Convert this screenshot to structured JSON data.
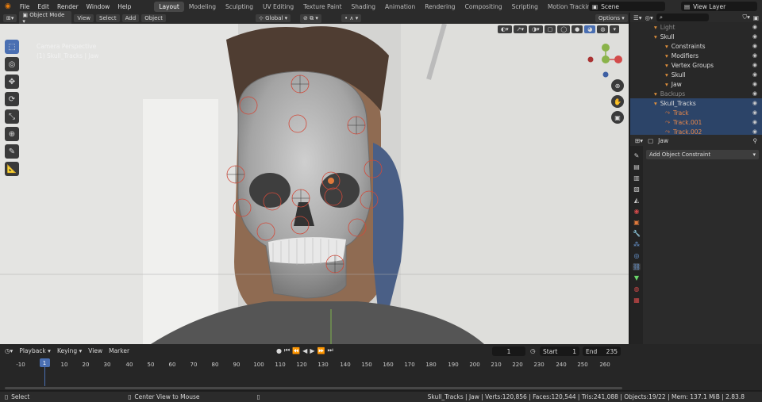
{
  "menus": [
    "File",
    "Edit",
    "Render",
    "Window",
    "Help"
  ],
  "workspaces": [
    "Layout",
    "Modeling",
    "Sculpting",
    "UV Editing",
    "Texture Paint",
    "Shading",
    "Animation",
    "Rendering",
    "Compositing",
    "Scripting",
    "Motion Tracking"
  ],
  "add_workspace": "+",
  "scene": "Scene",
  "view_layer": "View Layer",
  "header": {
    "mode": "Object Mode",
    "view": "View",
    "select": "Select",
    "add": "Add",
    "object": "Object",
    "orientation": "Global",
    "options": "Options"
  },
  "overlay": {
    "perspective": "Camera Perspective",
    "context": "(1) Skull_Tracks | Jaw"
  },
  "outliner": {
    "search_placeholder": "",
    "rows": [
      {
        "label": "Light",
        "indent": 30,
        "dim": true,
        "sel": false
      },
      {
        "label": "Skull",
        "indent": 30,
        "dim": false,
        "sel": false
      },
      {
        "label": "Constraints",
        "indent": 44,
        "dim": false,
        "sel": false
      },
      {
        "label": "Modifiers",
        "indent": 44,
        "dim": false,
        "sel": false
      },
      {
        "label": "Vertex Groups",
        "indent": 44,
        "dim": false,
        "sel": false
      },
      {
        "label": "Skull",
        "indent": 44,
        "dim": false,
        "sel": false
      },
      {
        "label": "Jaw",
        "indent": 44,
        "dim": false,
        "sel": false
      },
      {
        "label": "Backups",
        "indent": 30,
        "dim": true,
        "sel": false
      },
      {
        "label": "Skull_Tracks",
        "indent": 30,
        "dim": false,
        "sel": true
      },
      {
        "label": "Track",
        "indent": 44,
        "dim": false,
        "sel": true,
        "orange": true
      },
      {
        "label": "Track.001",
        "indent": 44,
        "dim": false,
        "sel": true,
        "orange": true
      },
      {
        "label": "Track.002",
        "indent": 44,
        "dim": false,
        "sel": true,
        "orange": true
      }
    ]
  },
  "properties": {
    "object": "Jaw",
    "add_constraint": "Add Object Constraint"
  },
  "timeline": {
    "playback": "Playback",
    "keying": "Keying",
    "view": "View",
    "marker": "Marker",
    "current_frame": "1",
    "start_label": "Start",
    "start": "1",
    "end_label": "End",
    "end": "235",
    "ticks": [
      "-10",
      "1",
      "10",
      "20",
      "30",
      "40",
      "50",
      "60",
      "70",
      "80",
      "90",
      "100",
      "110",
      "120",
      "130",
      "140",
      "150",
      "160",
      "170",
      "180",
      "190",
      "200",
      "210",
      "220",
      "230",
      "240",
      "250",
      "260"
    ]
  },
  "status": {
    "select": "Select",
    "center": "Center View to Mouse",
    "info": "Skull_Tracks | Jaw | Verts:120,856 | Faces:120,544 | Tris:241,088 | Objects:19/22 | Mem: 137.1 MiB | 2.83.8"
  },
  "colors": {
    "accent": "#4a6fb2",
    "track": "#e07a3c",
    "selected_row": "#2c4468"
  }
}
